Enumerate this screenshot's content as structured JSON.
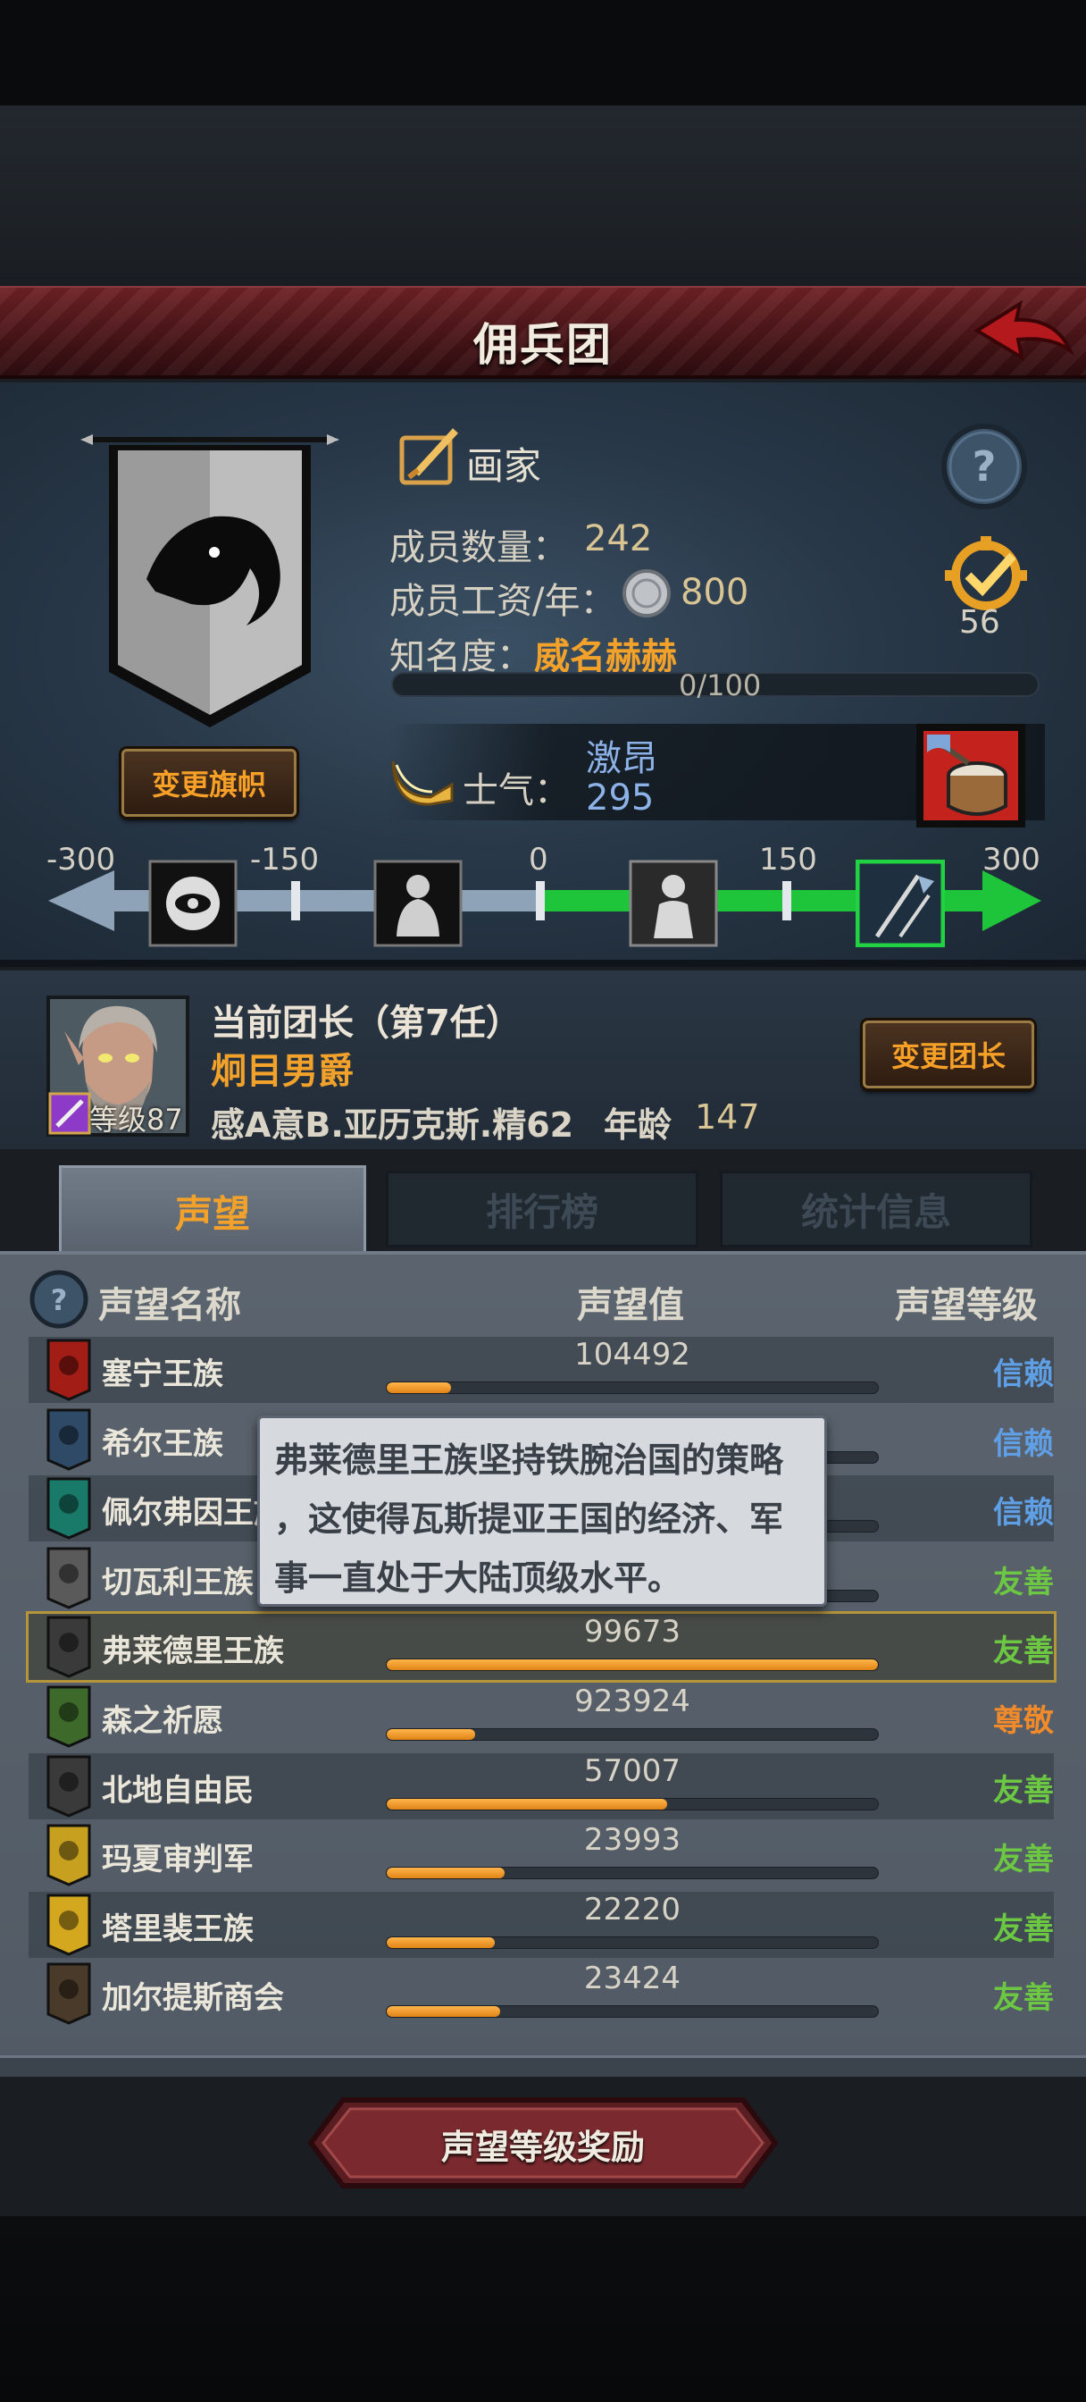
{
  "header": {
    "title": "佣兵团"
  },
  "company": {
    "class_name": "画家",
    "members_label": "成员数量：",
    "members_value": "242",
    "wage_label": "成员工资/年：",
    "wage_value": "800",
    "fame_label": "知名度：",
    "fame_value": "威名赫赫",
    "fame_progress": "0/100",
    "fame_fraction": 0,
    "rank_value": "56",
    "change_flag_label": "变更旗帜"
  },
  "morale": {
    "label": "士气：",
    "state": "激昂",
    "value": "295",
    "scale_ticks": [
      "-300",
      "-150",
      "0",
      "150",
      "300"
    ]
  },
  "leader": {
    "title": "当前团长（第7任）",
    "name": "炯目男爵",
    "level": "等级87",
    "info": "感A意B.亚历克斯.精62",
    "age_label": "年龄",
    "age_value": "147",
    "change_leader_label": "变更团长"
  },
  "tabs": [
    {
      "label": "声望",
      "active": true
    },
    {
      "label": "排行榜",
      "active": false
    },
    {
      "label": "统计信息",
      "active": false
    }
  ],
  "list_headers": {
    "name": "声望名称",
    "value": "声望值",
    "level": "声望等级"
  },
  "factions": [
    {
      "name": "塞宁王族",
      "value": "104492",
      "fill": 0.13,
      "level": "信赖",
      "level_color": "#5f9fe6"
    },
    {
      "name": "希尔王族",
      "value": "",
      "fill": 0.1,
      "level": "信赖",
      "level_color": "#5f9fe6"
    },
    {
      "name": "佩尔弗因王族",
      "value": "",
      "fill": 0.1,
      "level": "信赖",
      "level_color": "#5f9fe6"
    },
    {
      "name": "切瓦利王族",
      "value": "",
      "fill": 0.55,
      "level": "友善",
      "level_color": "#6cc843"
    },
    {
      "name": "弗莱德里王族",
      "value": "99673",
      "fill": 1.0,
      "level": "友善",
      "level_color": "#6cc843"
    },
    {
      "name": "森之祈愿",
      "value": "923924",
      "fill": 0.18,
      "level": "尊敬",
      "level_color": "#f08a2a"
    },
    {
      "name": "北地自由民",
      "value": "57007",
      "fill": 0.57,
      "level": "友善",
      "level_color": "#6cc843"
    },
    {
      "name": "玛夏审判军",
      "value": "23993",
      "fill": 0.24,
      "level": "友善",
      "level_color": "#6cc843"
    },
    {
      "name": "塔里裴王族",
      "value": "22220",
      "fill": 0.22,
      "level": "友善",
      "level_color": "#6cc843"
    },
    {
      "name": "加尔提斯商会",
      "value": "23424",
      "fill": 0.23,
      "level": "友善",
      "level_color": "#6cc843"
    }
  ],
  "tooltip": {
    "line1": "弗莱德里王族坚持铁腕治国的策略",
    "line2": "，这使得瓦斯提亚王国的经济、军",
    "line3": "事一直处于大陆顶级水平。"
  },
  "reward_button_label": "声望等级奖励",
  "colors": {
    "accent_orange": "#f2a22a",
    "trust_blue": "#5f9fe6",
    "friendly_green": "#6cc843",
    "respect_orange": "#f08a2a"
  }
}
